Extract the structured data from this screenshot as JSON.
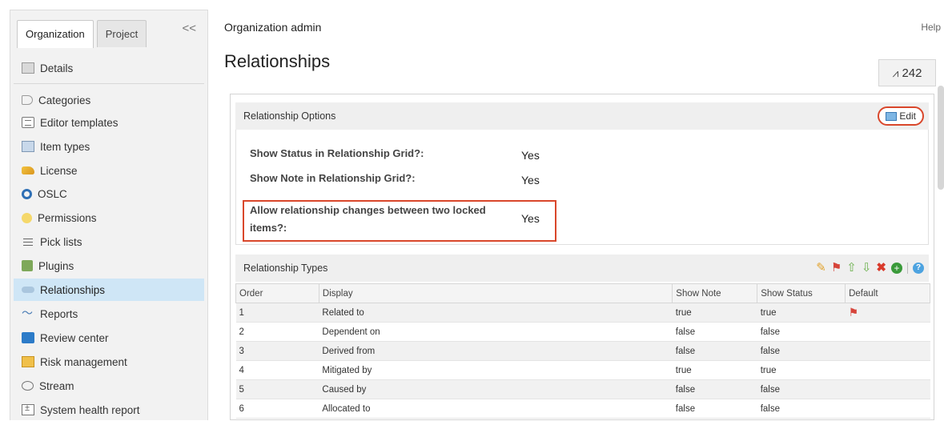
{
  "sidebar": {
    "tabs": [
      {
        "label": "Organization",
        "active": true
      },
      {
        "label": "Project",
        "active": false
      }
    ],
    "collapse_glyph": "<<",
    "items": [
      {
        "label": "Details",
        "icon": "details-icon"
      },
      {
        "label": "Categories",
        "icon": "tag-icon"
      },
      {
        "label": "Editor templates",
        "icon": "template-icon"
      },
      {
        "label": "Item types",
        "icon": "item-types-icon"
      },
      {
        "label": "License",
        "icon": "key-icon"
      },
      {
        "label": "OSLC",
        "icon": "oslc-icon"
      },
      {
        "label": "Permissions",
        "icon": "permissions-icon"
      },
      {
        "label": "Pick lists",
        "icon": "list-icon"
      },
      {
        "label": "Plugins",
        "icon": "plugin-icon"
      },
      {
        "label": "Relationships",
        "icon": "relationships-icon",
        "selected": true
      },
      {
        "label": "Reports",
        "icon": "reports-icon"
      },
      {
        "label": "Review center",
        "icon": "review-icon"
      },
      {
        "label": "Risk management",
        "icon": "risk-icon"
      },
      {
        "label": "Stream",
        "icon": "stream-icon"
      },
      {
        "label": "System health report",
        "icon": "health-icon"
      }
    ]
  },
  "header": {
    "admin_title": "Organization admin",
    "help": "Help",
    "page_title": "Relationships",
    "counter": "242",
    "counter_icon": "pulse-icon"
  },
  "options": {
    "title": "Relationship Options",
    "edit_label": "Edit",
    "rows": [
      {
        "label": "Show Status in Relationship Grid?:",
        "value": "Yes"
      },
      {
        "label": "Show Note in Relationship Grid?:",
        "value": "Yes"
      },
      {
        "label_line1": "Allow relationship changes between two locked",
        "label_line2": "items?:",
        "value": "Yes"
      }
    ]
  },
  "types": {
    "title": "Relationship Types",
    "toolbar_icons": [
      "pencil-icon",
      "flag-icon",
      "arrow-up-icon",
      "arrow-down-icon",
      "delete-icon",
      "add-icon",
      "help-icon"
    ],
    "columns": [
      "Order",
      "Display",
      "Show Note",
      "Show Status",
      "Default"
    ],
    "rows": [
      {
        "order": "1",
        "display": "Related to",
        "note": "true",
        "status": "true",
        "default": true
      },
      {
        "order": "2",
        "display": "Dependent on",
        "note": "false",
        "status": "false",
        "default": false
      },
      {
        "order": "3",
        "display": "Derived from",
        "note": "false",
        "status": "false",
        "default": false
      },
      {
        "order": "4",
        "display": "Mitigated by",
        "note": "true",
        "status": "true",
        "default": false
      },
      {
        "order": "5",
        "display": "Caused by",
        "note": "false",
        "status": "false",
        "default": false
      },
      {
        "order": "6",
        "display": "Allocated to",
        "note": "false",
        "status": "false",
        "default": false
      }
    ]
  },
  "colors": {
    "selected_bg": "#cfe6f6",
    "highlight_red": "#d9472b"
  }
}
